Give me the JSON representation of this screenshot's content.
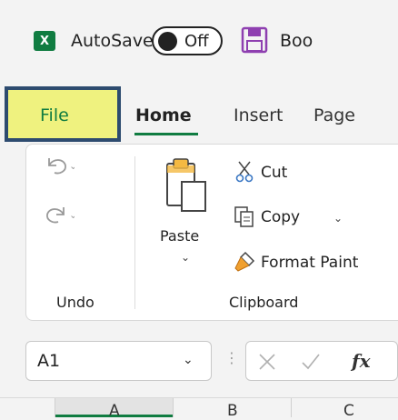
{
  "titlebar": {
    "app_icon_letter": "X",
    "autosave_label": "AutoSave",
    "toggle_state": "Off",
    "document_title": "Boo"
  },
  "tabs": [
    {
      "label": "File",
      "highlighted": true
    },
    {
      "label": "Home",
      "active": true
    },
    {
      "label": "Insert"
    },
    {
      "label": "Page"
    }
  ],
  "ribbon": {
    "undo_group": {
      "label": "Undo",
      "items": [
        "undo-icon",
        "redo-icon"
      ]
    },
    "clipboard_group": {
      "label": "Clipboard",
      "paste_label": "Paste",
      "cut_label": "Cut",
      "copy_label": "Copy",
      "format_painter_label": "Format Paint"
    }
  },
  "formula_bar": {
    "name_box_value": "A1",
    "fx_label": "fx"
  },
  "columns": [
    "A",
    "B",
    "C"
  ],
  "colors": {
    "excel_green": "#107c41",
    "highlight_yellow": "#eff27f",
    "highlight_border": "#2d4b6f",
    "format_painter_orange": "#f0a030",
    "save_icon_purple": "#8e3fb0"
  }
}
